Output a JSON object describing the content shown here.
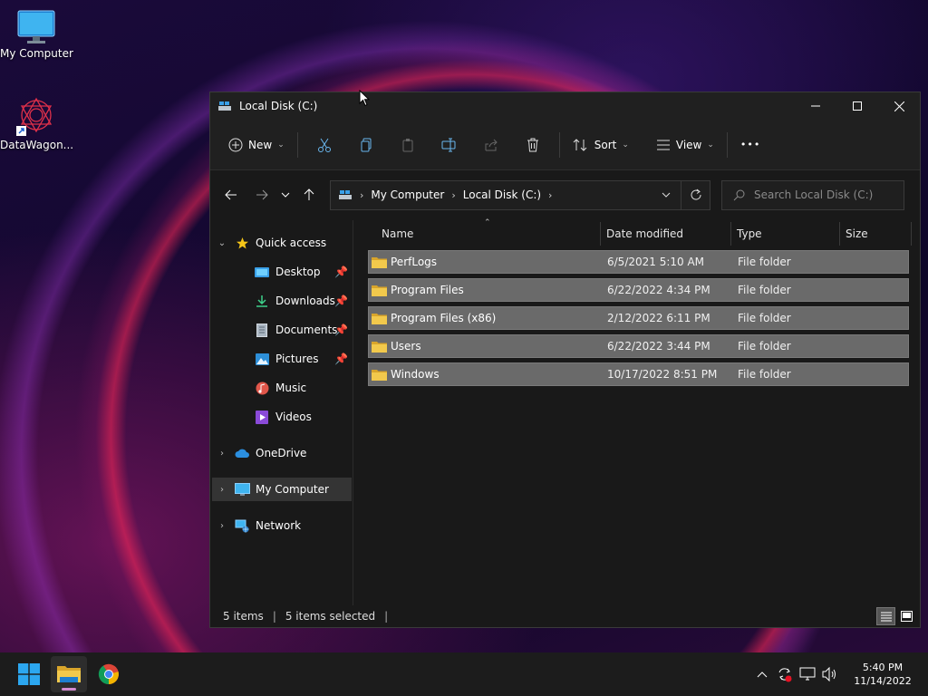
{
  "desktop": {
    "icons": [
      {
        "label": "My Computer",
        "icon": "monitor-icon"
      },
      {
        "label": "DataWagon...",
        "icon": "datawagon-shortcut-icon"
      }
    ]
  },
  "window": {
    "title": "Local Disk (C:)",
    "toolbar": {
      "new_label": "New",
      "sort_label": "Sort",
      "view_label": "View",
      "more_label": "•••"
    },
    "address": {
      "crumbs": [
        "My Computer",
        "Local Disk (C:)"
      ],
      "search_placeholder": "Search Local Disk (C:)"
    },
    "nav": {
      "quick_access": "Quick access",
      "items": [
        "Desktop",
        "Downloads",
        "Documents",
        "Pictures",
        "Music",
        "Videos"
      ],
      "onedrive": "OneDrive",
      "my_computer": "My Computer",
      "network": "Network"
    },
    "columns": {
      "name": "Name",
      "date": "Date modified",
      "type": "Type",
      "size": "Size"
    },
    "files": [
      {
        "name": "PerfLogs",
        "date": "6/5/2021 5:10 AM",
        "type": "File folder"
      },
      {
        "name": "Program Files",
        "date": "6/22/2022 4:34 PM",
        "type": "File folder"
      },
      {
        "name": "Program Files (x86)",
        "date": "2/12/2022 6:11 PM",
        "type": "File folder"
      },
      {
        "name": "Users",
        "date": "6/22/2022 3:44 PM",
        "type": "File folder"
      },
      {
        "name": "Windows",
        "date": "10/17/2022 8:51 PM",
        "type": "File folder"
      }
    ],
    "status": {
      "count": "5 items",
      "selected": "5 items selected"
    }
  },
  "taskbar": {
    "time": "5:40 PM",
    "date": "11/14/2022"
  },
  "colors": {
    "folder": "#e8b83a",
    "accent": "#3aa0e8",
    "row_selected": "#6a6a6a"
  }
}
